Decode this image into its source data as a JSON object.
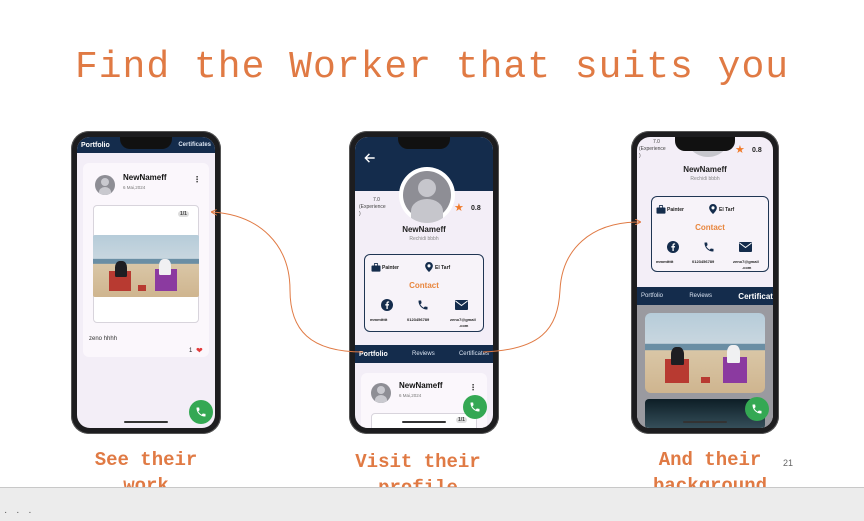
{
  "slide": {
    "title": "Find the Worker that suits you",
    "page_number": "21",
    "captions": [
      {
        "line1": "See their",
        "line2": "work"
      },
      {
        "line1": "Visit their",
        "line2": "profile"
      },
      {
        "line1": "And their",
        "line2": "background"
      }
    ],
    "accent_color": "#e07a44"
  },
  "phone1": {
    "tab_active": "Portfolio",
    "tab_other": "Certificates",
    "post": {
      "user": "NewNameff",
      "date": "6 Mai,2024",
      "counter": "1/1",
      "caption": "zeno hhhh",
      "likes": "1"
    }
  },
  "phone2": {
    "experience_value": "7.0",
    "experience_label": "(Experience",
    "experience_paren": ")",
    "rating": "0.8",
    "name": "NewNameff",
    "subtitle": "Rechidi bbbh",
    "job": "Painter",
    "location": "El Tarf",
    "contact_title": "Contact",
    "facebook": "mmmttttt",
    "phone": "0123456789",
    "email_line1": "zeno7@gmail",
    "email_line2": ".com",
    "tabs": [
      "Portfolio",
      "Reviews",
      "Certificates"
    ],
    "post_user": "NewNameff",
    "post_date": "6 Mai,2024",
    "post_counter": "1/1"
  },
  "phone3": {
    "experience_value": "7.0",
    "experience_label": "(Experience",
    "experience_paren": ")",
    "rating": "0.8",
    "name": "NewNameff",
    "subtitle": "Rechidi bbbh",
    "job": "Painter",
    "location": "El Tarf",
    "contact_title": "Contact",
    "facebook": "mmmttttt",
    "phone": "0123456789",
    "email_line1": "zeno7@gmail",
    "email_line2": ".com",
    "tabs": [
      "Portfolio",
      "Reviews",
      "Certificat"
    ]
  },
  "icons": {
    "call": "phone-icon",
    "heart": "heart-icon",
    "star": "star-icon",
    "briefcase": "briefcase-icon",
    "location": "location-pin-icon",
    "facebook": "facebook-icon",
    "mail": "mail-icon",
    "back": "back-arrow-icon"
  },
  "colors": {
    "header_navy": "#142c4c",
    "fab_green": "#34a853",
    "contact_orange": "#e8863e",
    "star_orange": "#f07a2a",
    "heart_red": "#e23b3b"
  }
}
